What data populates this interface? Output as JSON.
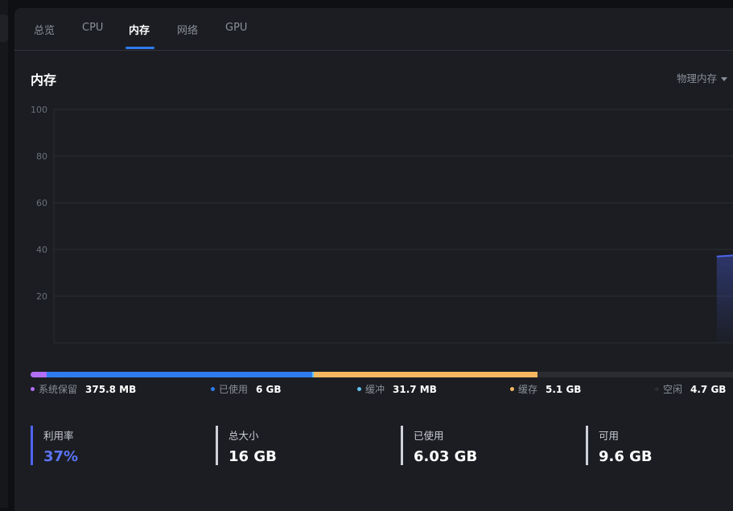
{
  "tabs": [
    {
      "label": "总览"
    },
    {
      "label": "CPU"
    },
    {
      "label": "内存"
    },
    {
      "label": "网络"
    },
    {
      "label": "GPU"
    }
  ],
  "section_title": "内存",
  "dropdown": {
    "label": "物理内存"
  },
  "colors": {
    "reserved": "#b26ef5",
    "used": "#2f7bf0",
    "buffer": "#63c2f0",
    "cache": "#f6b760",
    "free": "#2a2c31",
    "line": "#4e65f0"
  },
  "chart_data": {
    "type": "area",
    "y_ticks": [
      "100",
      "80",
      "60",
      "40",
      "20"
    ],
    "ylim": [
      0,
      100
    ],
    "grid": true,
    "series": [
      {
        "values": [
          {
            "x": 0.968,
            "y": 37
          },
          {
            "x": 1.0,
            "y": 37.6
          }
        ]
      }
    ]
  },
  "memory_bar": {
    "segments": [
      {
        "key": "reserved",
        "fraction": 0.023
      },
      {
        "key": "used",
        "fraction": 0.375
      },
      {
        "key": "buffer",
        "fraction": 0.002
      },
      {
        "key": "cache",
        "fraction": 0.316
      },
      {
        "key": "free",
        "fraction": 0.284
      }
    ]
  },
  "legend": [
    {
      "label": "系统保留",
      "value": "375.8 MB",
      "color": "#b26ef5"
    },
    {
      "label": "已使用",
      "value": "6 GB",
      "color": "#2f7bf0"
    },
    {
      "label": "缓冲",
      "value": "31.7 MB",
      "color": "#63c2f0"
    },
    {
      "label": "缓存",
      "value": "5.1 GB",
      "color": "#f6b760"
    },
    {
      "label": "空闲",
      "value": "4.7 GB",
      "color": "#2a2c31"
    }
  ],
  "stats": [
    {
      "label": "利用率",
      "value": "37%"
    },
    {
      "label": "总大小",
      "value": "16 GB"
    },
    {
      "label": "已使用",
      "value": "6.03 GB"
    },
    {
      "label": "可用",
      "value": "9.6 GB"
    }
  ]
}
